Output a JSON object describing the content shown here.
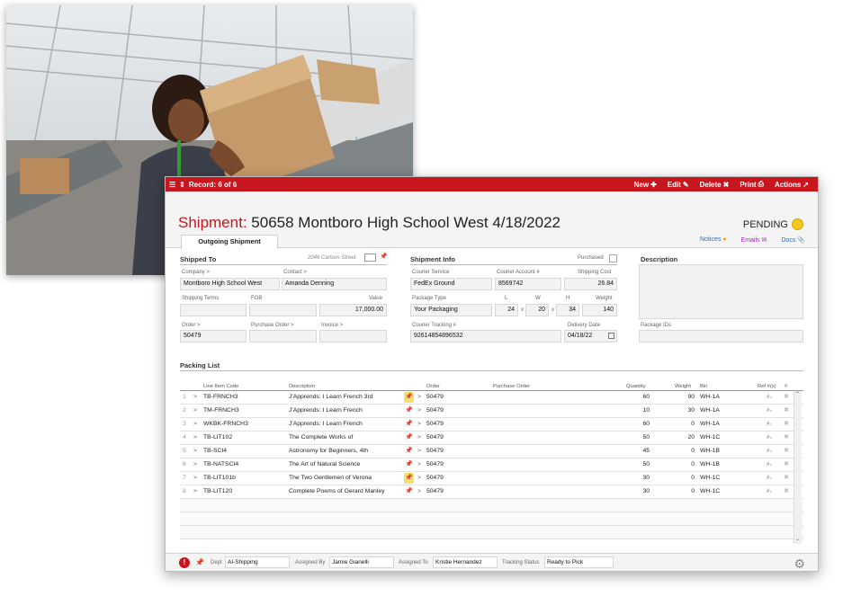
{
  "window": {
    "record_label": "Record: 6 of 6",
    "actions": {
      "new": "New",
      "edit": "Edit",
      "delete": "Delete",
      "print": "Print",
      "actions": "Actions"
    }
  },
  "title": {
    "label": "Shipment:",
    "text": "50658 Montboro High School West  4/18/2022",
    "status": "PENDING"
  },
  "tabs": {
    "active": "Outgoing Shipment",
    "notices": "Notices",
    "emails": "Emails",
    "docs": "Docs"
  },
  "shipped_to": {
    "heading": "Shipped To",
    "address": "2046 Carlson Street",
    "company_label": "Company >",
    "company": "Montboro High School West",
    "contact_label": "Contact >",
    "contact": "Amanda Denning",
    "terms_label": "Shipping Terms",
    "terms": "",
    "fob_label": "FOB",
    "fob": "",
    "value_label": "Value",
    "value": "17,000.00",
    "order_label": "Order >",
    "order": "50479",
    "po_label": "Purchase Order >",
    "po": "",
    "invoice_label": "Invoice >",
    "invoice": ""
  },
  "shipment_info": {
    "heading": "Shipment Info",
    "purchased_label": "Purchased",
    "service_label": "Courier Service",
    "service": "FedEx Ground",
    "account_label": "Courier Account #",
    "account": "8569742",
    "cost_label": "Shipping Cost",
    "cost": "26.84",
    "pkg_type_label": "Package Type",
    "pkg_type": "Your Packaging",
    "l_label": "L",
    "l": "24",
    "w_label": "W",
    "w": "20",
    "h_label": "H",
    "h": "34",
    "x": "x",
    "weight_label": "Weight",
    "weight": "140",
    "tracking_label": "Courier Tracking #",
    "tracking": "92614854896532",
    "delivery_label": "Delivery Date",
    "delivery": "04/18/22"
  },
  "description": {
    "heading": "Description",
    "package_ids_label": "Package IDs"
  },
  "packing": {
    "heading": "Packing List",
    "headers": {
      "code": "Line Item Code",
      "desc": "Description",
      "order": "Order",
      "po": "Purchase Order",
      "qty": "Quantity",
      "weight": "Weight",
      "bin": "Bin",
      "ref": "Ref #(s)"
    },
    "rows": [
      {
        "n": "1",
        "code": "TB-FRNCH3",
        "desc": "J'Apprends: I Learn French 3rd",
        "pin": true,
        "order": "50479",
        "qty": "60",
        "weight": "90",
        "bin": "WH-1A"
      },
      {
        "n": "2",
        "code": "TM-FRNCH3",
        "desc": "J'Apprends: I Learn French",
        "pin": false,
        "order": "50479",
        "qty": "10",
        "weight": "30",
        "bin": "WH-1A"
      },
      {
        "n": "3",
        "code": "WKBK-FRNCH3",
        "desc": "J'Apprends: I Learn French",
        "pin": false,
        "order": "50479",
        "qty": "60",
        "weight": "0",
        "bin": "WH-1A"
      },
      {
        "n": "4",
        "code": "TB-LIT102",
        "desc": "The Complete Works of",
        "pin": false,
        "order": "50479",
        "qty": "50",
        "weight": "20",
        "bin": "WH-1C"
      },
      {
        "n": "5",
        "code": "TB-SCI4",
        "desc": "Astronomy for Beginners, 4th",
        "pin": false,
        "order": "50479",
        "qty": "45",
        "weight": "0",
        "bin": "WH-1B"
      },
      {
        "n": "6",
        "code": "TB-NATSCI4",
        "desc": "The Art of Natural Science",
        "pin": false,
        "order": "50479",
        "qty": "50",
        "weight": "0",
        "bin": "WH-1B"
      },
      {
        "n": "7",
        "code": "TB-LIT101b",
        "desc": "The Two Gentlemen of Verona",
        "pin": true,
        "order": "50479",
        "qty": "30",
        "weight": "0",
        "bin": "WH-1C"
      },
      {
        "n": "8",
        "code": "TB-LIT120",
        "desc": "Complete Poems of Gerard Manley",
        "pin": false,
        "order": "50479",
        "qty": "30",
        "weight": "0",
        "bin": "WH-1C"
      }
    ]
  },
  "footer": {
    "dept_label": "Dept",
    "dept": "AI-Shipping",
    "assigned_by_label": "Assigned By",
    "assigned_by": "Jamie Gianelli",
    "assigned_to_label": "Assigned To",
    "assigned_to": "Kristie Hernandez",
    "tracking_status_label": "Tracking Status",
    "tracking_status": "Ready to Pick"
  },
  "colors": {
    "brand_red": "#c8161f",
    "status_yellow": "#f5c61b",
    "link_blue": "#2a6fb8"
  }
}
